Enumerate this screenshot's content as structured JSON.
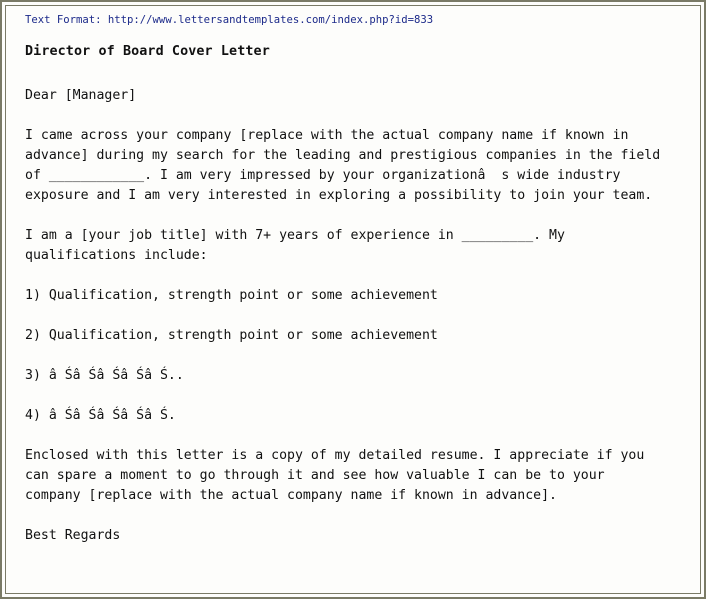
{
  "source_line": "Text Format: http://www.lettersandtemplates.com/index.php?id=833",
  "title": "Director of Board Cover Letter",
  "salutation": "Dear [Manager]",
  "paragraphs": [
    "I came across your company [replace with the actual company name if known in\nadvance] during my search for the leading and prestigious companies in the field\nof ____________. I am very impressed by your organizationâ  s wide industry\nexposure and I am very interested in exploring a possibility to join your team.",
    "I am a [your job title] with 7+ years of experience in _________. My\nqualifications include:",
    "1) Qualification, strength point or some achievement",
    "2) Qualification, strength point or some achievement",
    "3) â Śâ Śâ Śâ Śâ Ś..",
    "4) â Śâ Śâ Śâ Śâ Ś.",
    "Enclosed with this letter is a copy of my detailed resume. I appreciate if you\ncan spare a moment to go through it and see how valuable I can be to your\ncompany [replace with the actual company name if known in advance]."
  ],
  "closing": "Best Regards"
}
